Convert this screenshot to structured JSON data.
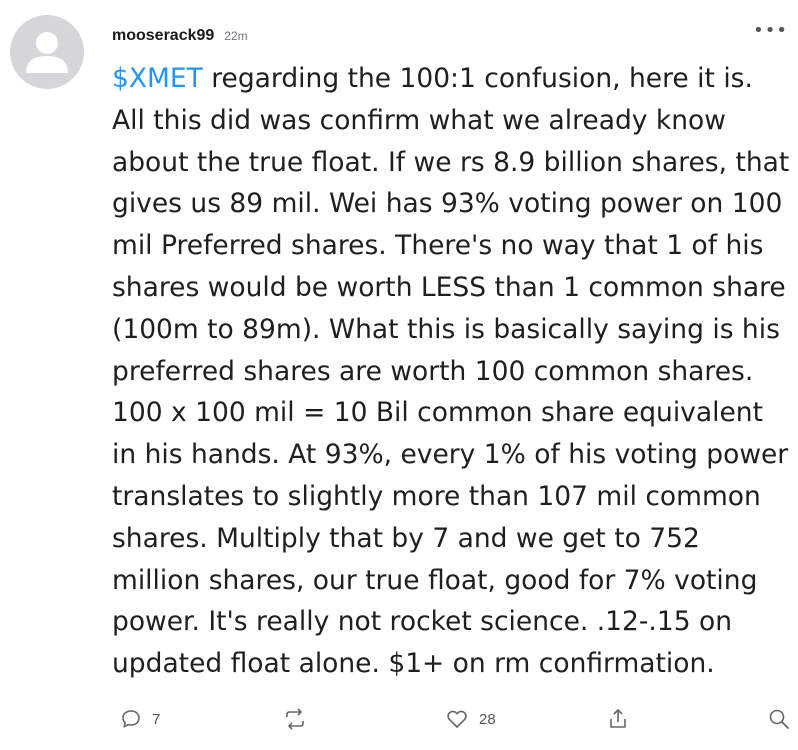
{
  "post": {
    "username": "mooserack99",
    "timestamp": "22m",
    "ticker": "$XMET",
    "body": " regarding the 100:1 confusion, here it is. All this did was confirm what we already know about the true float. If we rs 8.9 billion shares, that gives us 89 mil. Wei has 93% voting power on 100 mil Preferred shares. There's no way that 1 of his shares would be worth LESS than 1 common share (100m to 89m). What this is basically saying is his preferred shares are worth 100 common shares. 100 x 100 mil = 10 Bil common share equivalent in his hands. At 93%, every 1% of his voting power translates to slightly more than 107 mil common shares. Multiply that by 7 and we get to 752 million shares, our true float, good for 7% voting power. It's really not rocket science. .12-.15 on updated float alone. $1+ on rm confirmation."
  },
  "actions": {
    "reply_count": "7",
    "like_count": "28"
  },
  "icons": {
    "avatar": "default-user-avatar",
    "more": "more-dots-icon",
    "reply": "comment-bubble-icon",
    "reshare": "reshare-icon",
    "like": "heart-icon",
    "share": "share-upload-icon",
    "search": "search-icon"
  },
  "colors": {
    "ticker": "#2196f3",
    "avatar_bg": "#d4d6d9",
    "icon": "#666666"
  }
}
